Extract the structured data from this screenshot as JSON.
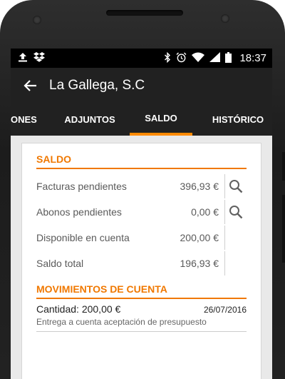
{
  "status_bar": {
    "time": "18:37",
    "left_icons": [
      "upload-icon",
      "dropbox-icon"
    ],
    "right_icons": [
      "bluetooth-icon",
      "alarm-icon",
      "wifi-icon",
      "signal-icon",
      "battery-icon"
    ]
  },
  "app_bar": {
    "back_icon": "arrow-left-icon",
    "title": "La Gallega, S.C"
  },
  "tabs": [
    {
      "label": "ONES",
      "active": false
    },
    {
      "label": "ADJUNTOS",
      "active": false
    },
    {
      "label": "SALDO",
      "active": true
    },
    {
      "label": "HISTÓRICO",
      "active": false
    }
  ],
  "saldo": {
    "heading": "SALDO",
    "rows": [
      {
        "label": "Facturas pendientes",
        "value": "396,93 €",
        "action_icon": "search-icon"
      },
      {
        "label": "Abonos pendientes",
        "value": "0,00 €",
        "action_icon": "search-icon"
      },
      {
        "label": "Disponible en cuenta",
        "value": "200,00 €",
        "action_icon": ""
      },
      {
        "label": "Saldo total",
        "value": "196,93 €",
        "action_icon": ""
      }
    ]
  },
  "movimientos": {
    "heading": "MOVIMIENTOS DE CUENTA",
    "items": [
      {
        "amount": "Cantidad: 200,00 €",
        "date": "26/07/2016",
        "description": "Entrega a cuenta aceptación de presupuesto"
      }
    ]
  },
  "colors": {
    "accent": "#f07800",
    "toolbar": "#212121",
    "status_bar": "#000000",
    "background": "#e9e9e9"
  }
}
